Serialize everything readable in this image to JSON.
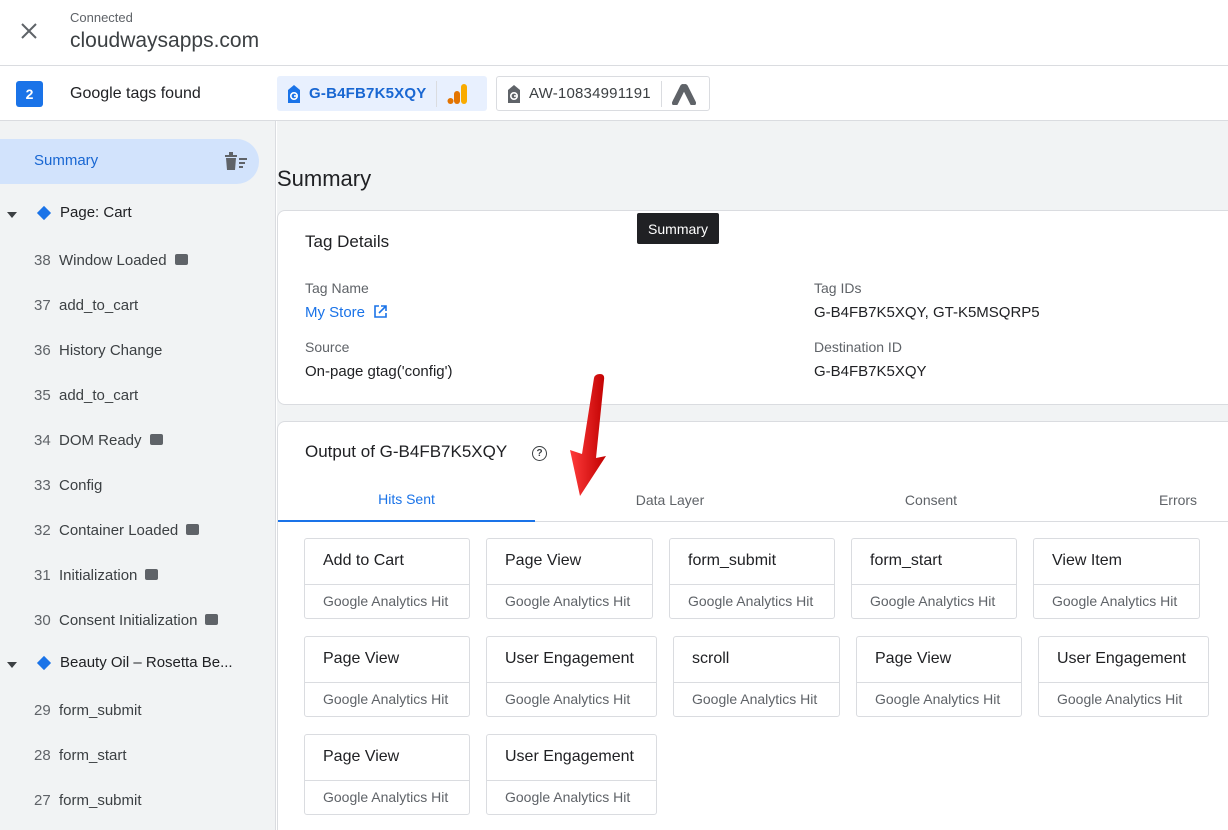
{
  "header": {
    "status": "Connected",
    "domain": "cloudwaysapps.com"
  },
  "tagbar": {
    "count": "2",
    "label": "Google tags found",
    "tags": [
      {
        "id": "G-B4FB7K5XQY",
        "icon": "google-analytics-icon"
      },
      {
        "id": "AW-10834991191",
        "icon": "google-ads-icon"
      }
    ]
  },
  "sidebar": {
    "summary_label": "Summary",
    "pages": [
      {
        "title": "Page: Cart"
      },
      {
        "title": "Beauty Oil – Rosetta Be..."
      }
    ],
    "events": [
      {
        "num": "38",
        "name": "Window Loaded",
        "code": true
      },
      {
        "num": "37",
        "name": "add_to_cart",
        "code": false
      },
      {
        "num": "36",
        "name": "History Change",
        "code": false
      },
      {
        "num": "35",
        "name": "add_to_cart",
        "code": false
      },
      {
        "num": "34",
        "name": "DOM Ready",
        "code": true
      },
      {
        "num": "33",
        "name": "Config",
        "code": false
      },
      {
        "num": "32",
        "name": "Container Loaded",
        "code": true
      },
      {
        "num": "31",
        "name": "Initialization",
        "code": true
      },
      {
        "num": "30",
        "name": "Consent Initialization",
        "code": true
      },
      {
        "num": "29",
        "name": "form_submit",
        "code": false
      },
      {
        "num": "28",
        "name": "form_start",
        "code": false
      },
      {
        "num": "27",
        "name": "form_submit",
        "code": false
      }
    ]
  },
  "main": {
    "title": "Summary",
    "tooltip": "Summary",
    "details": {
      "title": "Tag Details",
      "tag_name_label": "Tag Name",
      "tag_name_value": "My Store",
      "tag_ids_label": "Tag IDs",
      "tag_ids_value": "G-B4FB7K5XQY, GT-K5MSQRP5",
      "source_label": "Source",
      "source_value": "On-page gtag('config')",
      "destination_label": "Destination ID",
      "destination_value": "G-B4FB7K5XQY"
    },
    "output": {
      "title": "Output of G-B4FB7K5XQY",
      "tabs": [
        "Hits Sent",
        "Data Layer",
        "Consent",
        "Errors"
      ],
      "active_tab": "Hits Sent",
      "hits": [
        {
          "name": "Add to Cart",
          "type": "Google Analytics Hit"
        },
        {
          "name": "Page View",
          "type": "Google Analytics Hit"
        },
        {
          "name": "form_submit",
          "type": "Google Analytics Hit"
        },
        {
          "name": "form_start",
          "type": "Google Analytics Hit"
        },
        {
          "name": "View Item",
          "type": "Google Analytics Hit"
        },
        {
          "name": "Page View",
          "type": "Google Analytics Hit"
        },
        {
          "name": "User Engagement",
          "type": "Google Analytics Hit"
        },
        {
          "name": "scroll",
          "type": "Google Analytics Hit"
        },
        {
          "name": "Page View",
          "type": "Google Analytics Hit"
        },
        {
          "name": "User Engagement",
          "type": "Google Analytics Hit"
        },
        {
          "name": "Page View",
          "type": "Google Analytics Hit"
        },
        {
          "name": "User Engagement",
          "type": "Google Analytics Hit"
        }
      ]
    }
  },
  "colors": {
    "accent": "#1a73e8",
    "sidebar_bg": "#f1f3f4",
    "selected_bg": "#d2e3fc",
    "annotation_arrow": "#e8151b"
  }
}
